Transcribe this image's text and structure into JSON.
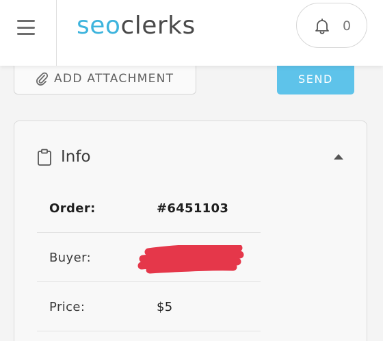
{
  "header": {
    "logo_part1": "seo",
    "logo_part2": "clerks",
    "notification_count": "0"
  },
  "actions": {
    "attach_label": "ADD ATTACHMENT",
    "send_label": "SEND"
  },
  "info": {
    "title": "Info",
    "rows": [
      {
        "label": "Order:",
        "value": "#6451103"
      },
      {
        "label": "Buyer:",
        "value": ""
      },
      {
        "label": "Price:",
        "value": "$5"
      }
    ]
  },
  "colors": {
    "brand_blue": "#3eb4dd",
    "send_button": "#5ec3ea",
    "redaction": "#e5374a"
  }
}
